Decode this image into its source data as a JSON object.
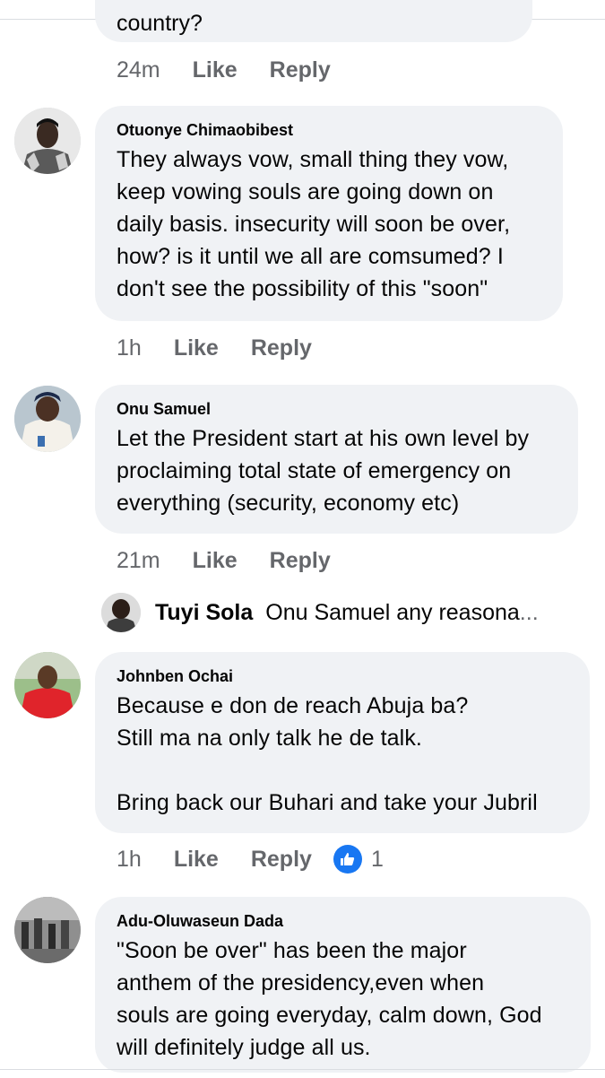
{
  "partial_comment": {
    "text": "country?"
  },
  "actions_labels": {
    "like": "Like",
    "reply": "Reply"
  },
  "top_actions": {
    "time": "24m"
  },
  "comments": [
    {
      "author": "Otuonye Chimaobibest",
      "text": "They always vow, small thing they vow,\nkeep vowing souls are going down on\ndaily basis. insecurity will soon be over,\nhow? is it until we all are comsumed? I\ndon't see the possibility of this \"soon\"",
      "time": "1h"
    },
    {
      "author": "Onu Samuel",
      "text": "Let the President start at his own level by\nproclaiming total state of emergency on\neverything (security, economy etc)",
      "time": "21m",
      "reply_preview": {
        "author": "Tuyi Sola",
        "text": "Onu Samuel any reasona",
        "ellipsis": "..."
      }
    },
    {
      "author": "Johnben Ochai",
      "text": "Because e don de reach Abuja ba?\nStill ma na only talk he de talk.\n\nBring back our Buhari and take your Jubril",
      "time": "1h",
      "reaction": {
        "icon": "thumbs-up-icon",
        "count": "1",
        "color": "#1877f2"
      }
    },
    {
      "author": "Adu-Oluwaseun Dada",
      "text": "\"Soon be over\" has been the major\nanthem of the presidency,even when\nsouls are going everyday, calm down, God\nwill definitely judge all us."
    }
  ],
  "colors": {
    "bubble": "#f0f2f5",
    "meta_text": "#65676b",
    "primary_text": "#050505",
    "like_blue": "#1877f2"
  }
}
